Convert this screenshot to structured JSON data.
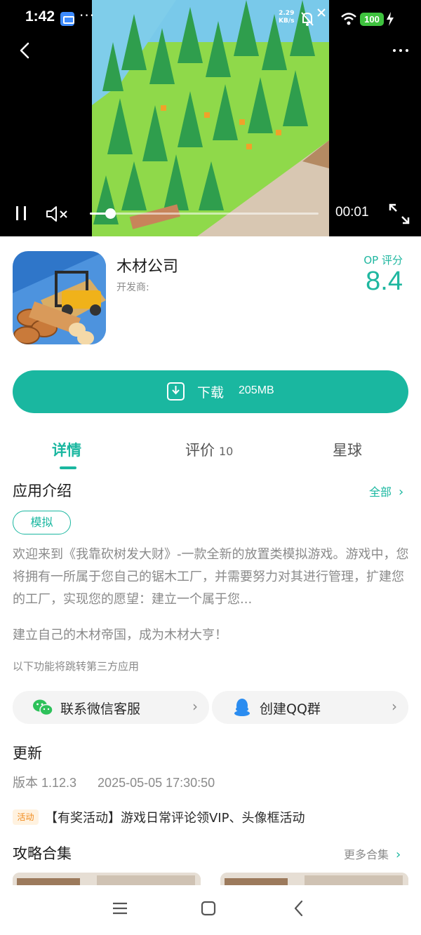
{
  "status_bar": {
    "time": "1:42",
    "dots": "···",
    "net_speed_value": "2.29",
    "net_speed_unit": "KB/s",
    "battery": "100"
  },
  "video": {
    "elapsed": "00:01",
    "progress": 0.09
  },
  "app": {
    "name": "木材公司",
    "developer_label": "开发商:",
    "score_label": "OP 评分",
    "score": "8.4"
  },
  "download": {
    "label": "下载",
    "size": "205MB"
  },
  "tabs": [
    {
      "label": "详情"
    },
    {
      "label": "评价",
      "count": "10"
    },
    {
      "label": "星球"
    }
  ],
  "intro": {
    "title": "应用介绍",
    "more": "全部",
    "tag": "模拟",
    "text": "欢迎来到《我靠砍树发大财》-一款全新的放置类模拟游戏。游戏中，您将拥有一所属于您自己的锯木工厂，并需要努力对其进行管理，扩建您的工厂，实现您的愿望：建立一个属于您...",
    "text2": "建立自己的木材帝国，成为木材大亨！",
    "third_party_note": "以下功能将跳转第三方应用"
  },
  "contacts": {
    "wechat": "联系微信客服",
    "qq": "创建QQ群"
  },
  "update": {
    "title": "更新",
    "version": "版本 1.12.3",
    "date": "2025-05-05 17:30:50",
    "event_badge": "活动",
    "event_text": "【有奖活动】游戏日常评论领VIP、头像框活动"
  },
  "guides": {
    "title": "攻略合集",
    "more": "更多合集"
  },
  "colors": {
    "accent": "#1ab7a0",
    "battery": "#3ec23e",
    "event": "#f08a1c"
  }
}
